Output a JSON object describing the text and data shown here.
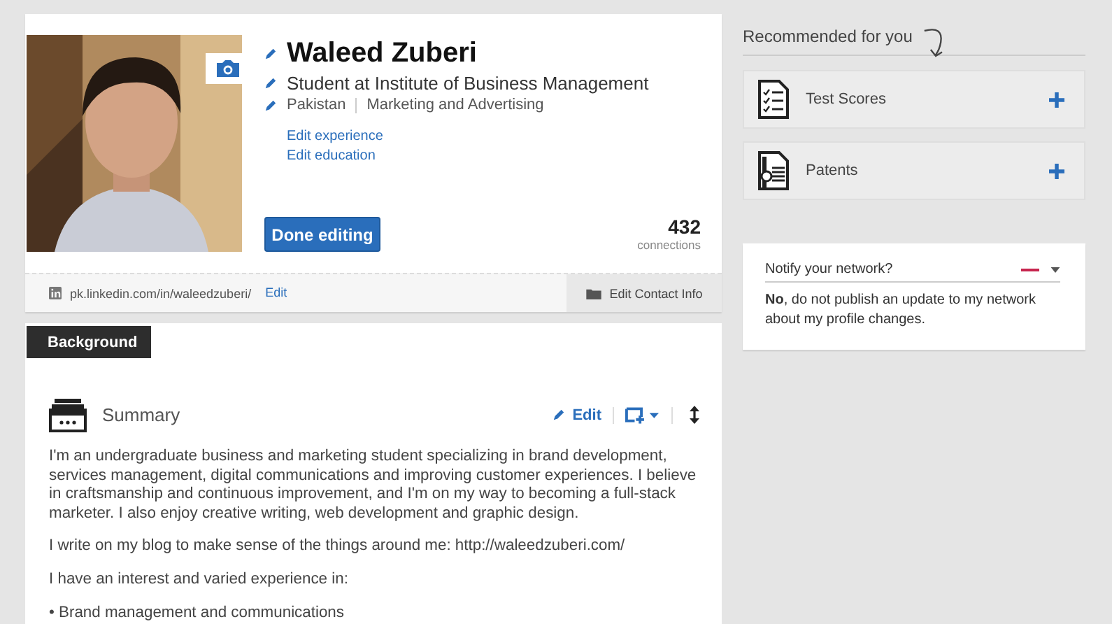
{
  "profile": {
    "name": "Waleed Zuberi",
    "headline": "Student at Institute of Business Management",
    "location": "Pakistan",
    "industry": "Marketing and Advertising",
    "links": [
      "Edit experience",
      "Edit education"
    ],
    "done_button": "Done editing",
    "connections_count": "432",
    "connections_label": "connections",
    "public_url": "pk.linkedin.com/in/waleedzuberi/",
    "url_edit": "Edit",
    "contact_button": "Edit Contact Info"
  },
  "section_tab": {
    "label": "Background",
    "selected": true
  },
  "summary": {
    "title": "Summary",
    "edit": "Edit",
    "paragraphs": [
      "I'm an undergraduate business and marketing student specializing in brand development, services management, digital communications and improving customer experiences. I believe in craftsmanship and continuous improvement, and I'm on my way to becoming a full-stack marketer. I also enjoy creative writing, web development and graphic design.",
      "I write on my blog to make sense of the things around me: http://waleedzuberi.com/",
      "I have an interest and varied experience in:",
      "• Brand management and communications"
    ]
  },
  "recommended": {
    "title": "Recommended for you",
    "items": [
      {
        "label": "Test Scores",
        "kind": "test-scores"
      },
      {
        "label": "Patents",
        "kind": "patents"
      }
    ]
  },
  "notify": {
    "label": "Notify your network?",
    "on": false,
    "text": "**No**, do not publish an update to my network about my profile changes."
  }
}
